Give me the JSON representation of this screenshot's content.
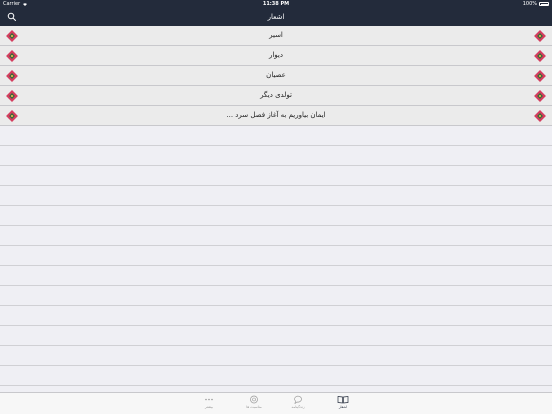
{
  "status": {
    "carrier": "Carrier",
    "time": "11:38 PM",
    "battery": "100%"
  },
  "nav": {
    "title": "اشعار"
  },
  "list": [
    "اسیر",
    "دیوار",
    "عصیان",
    "تولدی دیگر",
    "ایمان بیاوریم به آغاز فصل سرد ..."
  ],
  "tabs": [
    {
      "label": "بیشتر",
      "icon": "more-icon"
    },
    {
      "label": "مناسبت ها",
      "icon": "clock-icon"
    },
    {
      "label": "زندگینامه",
      "icon": "speech-icon"
    },
    {
      "label": "اشعار",
      "icon": "book-icon"
    }
  ],
  "colors": {
    "nav": "#232b3b",
    "accent": "#d43d5f",
    "tab_active": "#232b3b"
  }
}
